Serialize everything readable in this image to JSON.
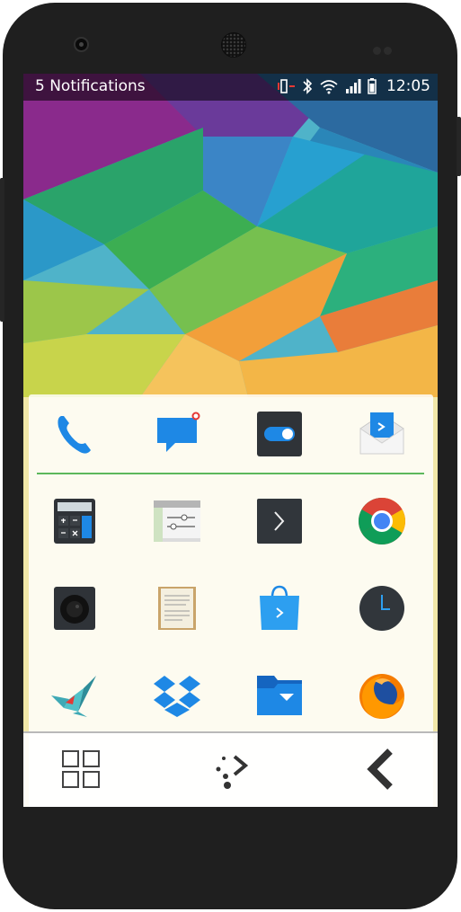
{
  "status_bar": {
    "notifications_label": "5 Notifications",
    "time": "12:05",
    "icons": [
      "vibrate-icon",
      "bluetooth-icon",
      "wifi-icon",
      "signal-icon",
      "battery-icon"
    ]
  },
  "favorites": [
    {
      "name": "phone-app",
      "icon": "phone-icon"
    },
    {
      "name": "messages-app",
      "icon": "chat-bubble-icon"
    },
    {
      "name": "settings-toggle-app",
      "icon": "toggle-icon"
    },
    {
      "name": "email-app",
      "icon": "envelope-icon"
    }
  ],
  "apps": [
    {
      "name": "calculator-app",
      "icon": "calculator-icon"
    },
    {
      "name": "system-settings-app",
      "icon": "window-sliders-icon"
    },
    {
      "name": "terminal-app",
      "icon": "terminal-icon"
    },
    {
      "name": "chrome-app",
      "icon": "chrome-icon"
    },
    {
      "name": "camera-app",
      "icon": "camera-icon"
    },
    {
      "name": "notes-app",
      "icon": "notepad-icon"
    },
    {
      "name": "store-app",
      "icon": "shopping-bag-icon"
    },
    {
      "name": "clock-app",
      "icon": "clock-icon"
    },
    {
      "name": "bird-app",
      "icon": "paper-crane-icon"
    },
    {
      "name": "dropbox-app",
      "icon": "dropbox-icon"
    },
    {
      "name": "files-app",
      "icon": "folder-icon"
    },
    {
      "name": "firefox-app",
      "icon": "firefox-icon"
    }
  ],
  "nav_bar": {
    "buttons": [
      "app-grid-icon",
      "home-kde-icon",
      "back-chevron-icon"
    ]
  },
  "colors": {
    "divider": "#5cb85c",
    "phone_body": "#1f1f1f",
    "accent_blue": "#1e88e5"
  }
}
